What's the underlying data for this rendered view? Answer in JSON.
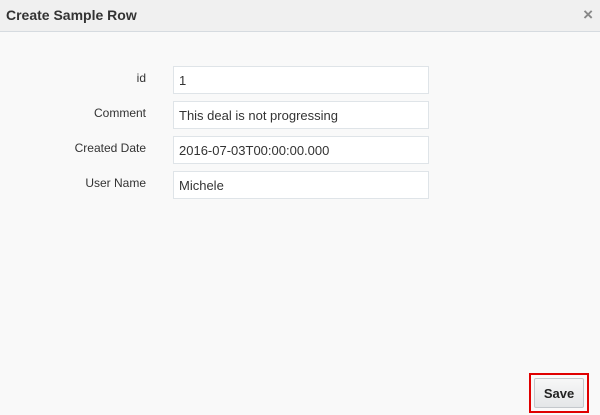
{
  "dialog": {
    "title": "Create Sample Row",
    "close_icon": "×"
  },
  "fields": [
    {
      "label": "id",
      "value": "1"
    },
    {
      "label": "Comment",
      "value": "This deal is not progressing"
    },
    {
      "label": "Created Date",
      "value": "2016-07-03T00:00:00.000"
    },
    {
      "label": "User Name",
      "value": "Michele"
    }
  ],
  "actions": {
    "save_label": "Save"
  },
  "colors": {
    "highlight": "#e00000"
  }
}
